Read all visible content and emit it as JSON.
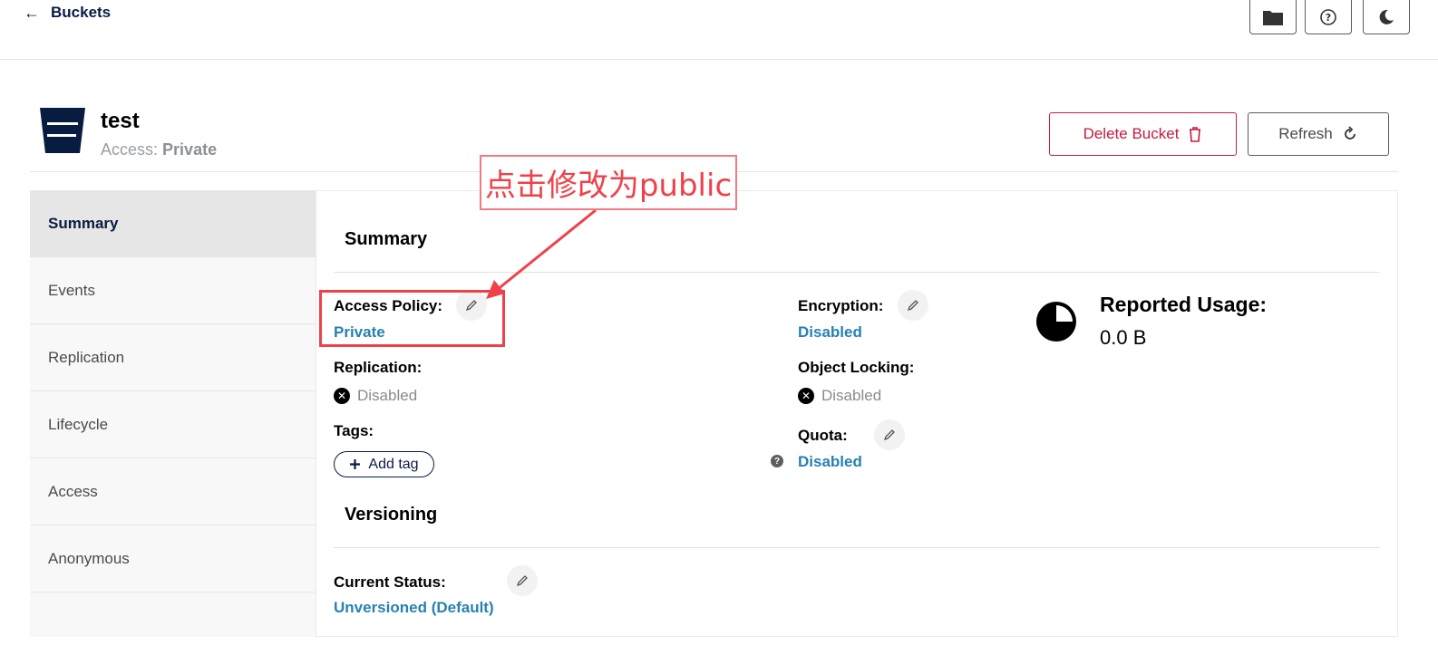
{
  "topbar": {
    "back_label": "Buckets",
    "icons": [
      "folder-icon",
      "help-circle-icon",
      "moon-icon"
    ]
  },
  "bucket": {
    "name": "test",
    "access_label": "Access:",
    "access_value": "Private"
  },
  "actions": {
    "delete_label": "Delete Bucket",
    "refresh_label": "Refresh"
  },
  "sidebar": {
    "items": [
      {
        "label": "Summary",
        "active": true
      },
      {
        "label": "Events"
      },
      {
        "label": "Replication"
      },
      {
        "label": "Lifecycle"
      },
      {
        "label": "Access"
      },
      {
        "label": "Anonymous"
      }
    ]
  },
  "summary": {
    "title": "Summary",
    "access_policy": {
      "label": "Access Policy:",
      "value": "Private"
    },
    "replication": {
      "label": "Replication:",
      "value": "Disabled"
    },
    "tags": {
      "label": "Tags:",
      "add_label": "Add tag"
    },
    "encryption": {
      "label": "Encryption:",
      "value": "Disabled"
    },
    "object_locking": {
      "label": "Object Locking:",
      "value": "Disabled"
    },
    "quota": {
      "label": "Quota:",
      "value": "Disabled"
    },
    "usage": {
      "label": "Reported Usage:",
      "value": "0.0 B"
    }
  },
  "versioning": {
    "title": "Versioning",
    "status_label": "Current Status:",
    "status_value": "Unversioned (Default)"
  },
  "annotation": {
    "text": "点击修改为public",
    "color": "#f0414a"
  },
  "colors": {
    "brand_navy": "#081c42",
    "link_blue": "#2781b0",
    "danger": "#c51b3c"
  }
}
